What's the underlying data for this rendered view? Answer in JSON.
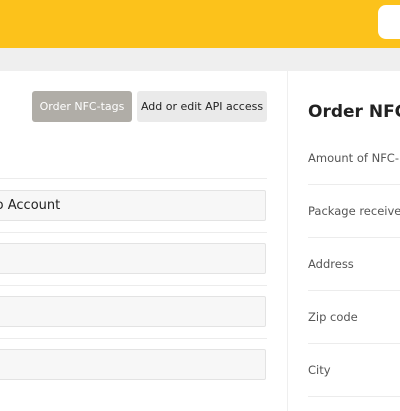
{
  "header": {
    "brand_color": "#fcc21b"
  },
  "toolbar": {
    "order_nfc_label": "Order NFC-tags",
    "api_access_label": "Add or edit API access"
  },
  "account_form": {
    "fields": [
      {
        "value": "mo Account"
      },
      {
        "value": ""
      },
      {
        "value": ""
      },
      {
        "value": ""
      }
    ]
  },
  "order_panel": {
    "title": "Order NFC-",
    "labels": [
      "Amount of NFC-",
      "Package receiver",
      "Address",
      "Zip code",
      "City"
    ]
  }
}
